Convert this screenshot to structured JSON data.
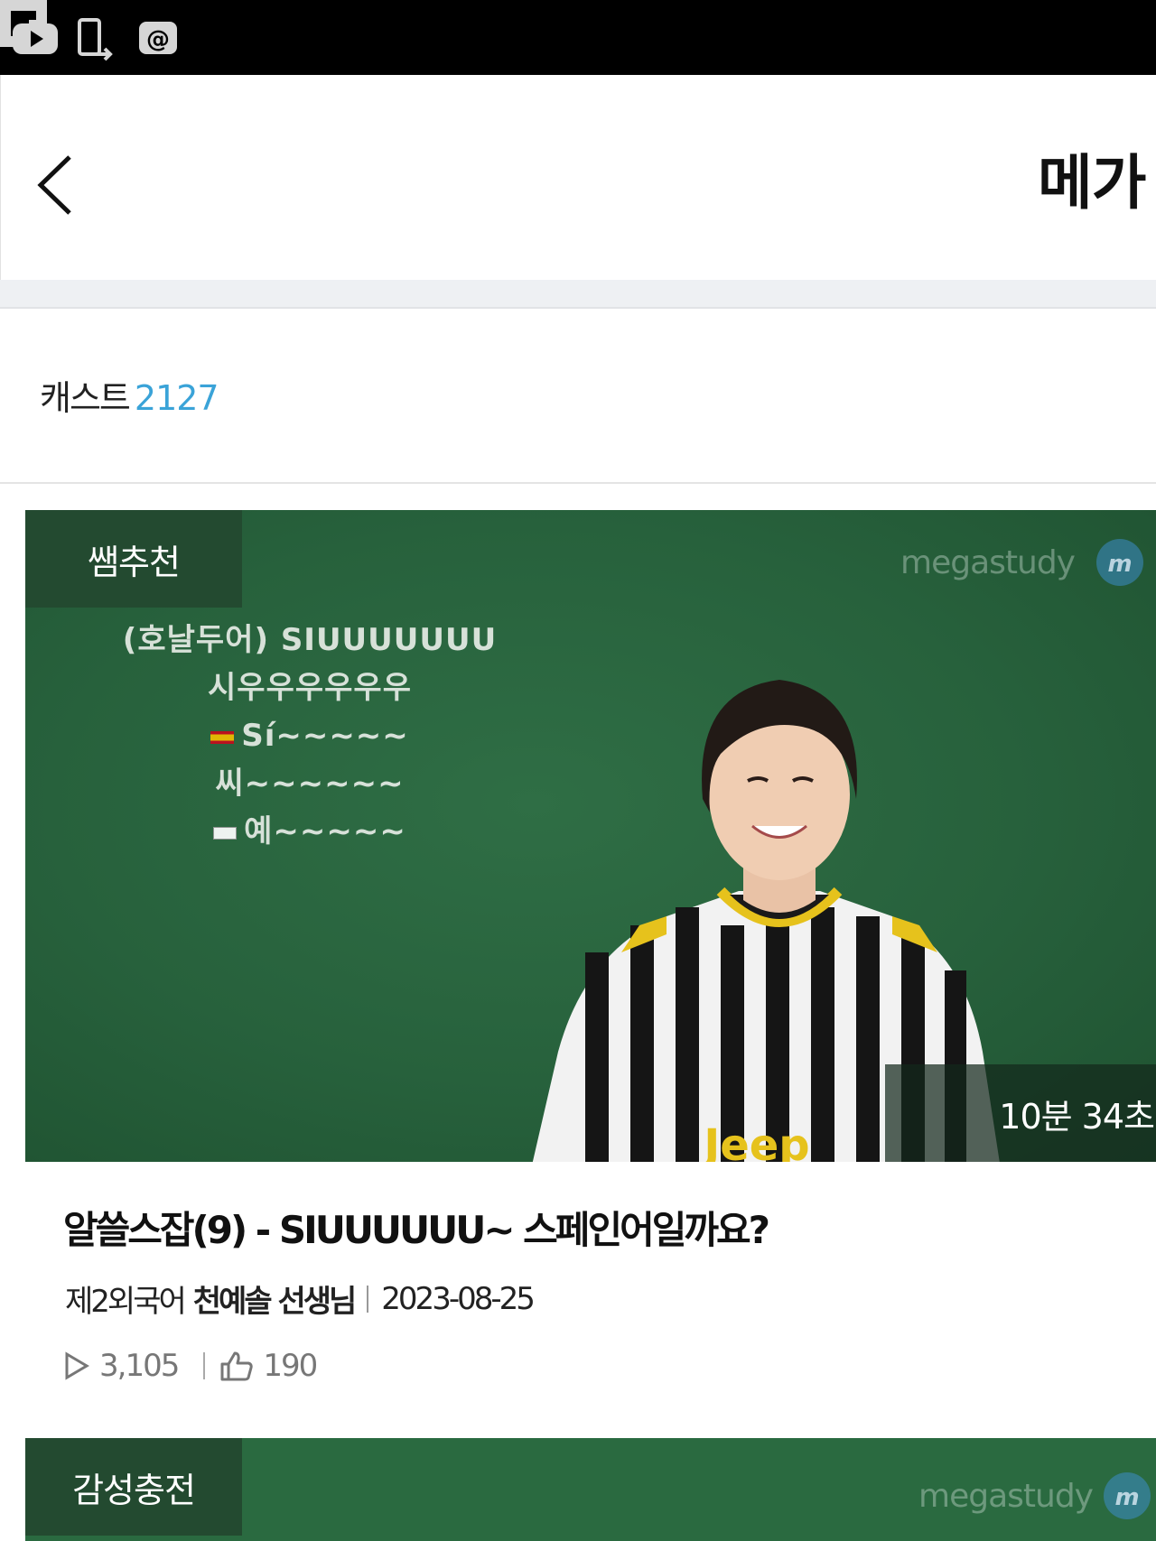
{
  "status_bar": {
    "icons": [
      "youtube-icon",
      "phone-transfer-icon",
      "at-sign-icon",
      "flipboard-icon"
    ]
  },
  "header": {
    "back_icon": "chevron-left-icon",
    "title": "메가"
  },
  "cast": {
    "label": "캐스트",
    "count": "2127"
  },
  "cards": [
    {
      "badge": "쌤추천",
      "watermark": "megastudy",
      "board_lines": [
        "(호날두어) SIUUUUUUU",
        "시우우우우우우",
        "Sí~~~~~",
        "씨~~~~~~",
        "예~~~~~"
      ],
      "duration": "10분 34초",
      "title": "알쓸스잡(9) - SIUUUUUU~ 스페인어일까요?",
      "subject": "제2외국어",
      "teacher": "천예솔 선생님",
      "date": "2023-08-25",
      "views": "3,105",
      "likes": "190"
    },
    {
      "badge": "감성충전",
      "watermark": "megastudy"
    }
  ],
  "colors": {
    "accent": "#3aa3d8",
    "badge_bg": "#234a30",
    "board_green": "#2a6a40"
  }
}
